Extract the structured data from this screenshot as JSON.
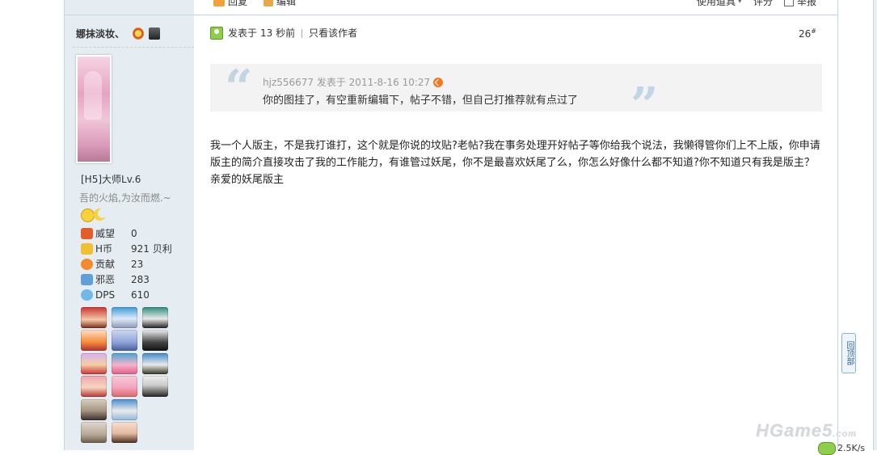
{
  "prev_post_actions": {
    "reply": "回复",
    "edit": "编辑",
    "use_item": "使用道具",
    "rate": "评分",
    "report": "举报"
  },
  "author": {
    "name": "娜抹淡妆、",
    "level": "[H5]大师Lv.6",
    "signature": "吾的火焰,为汝而燃.~",
    "stats": [
      {
        "label": "威望",
        "value": "0",
        "icon": "crown-icon"
      },
      {
        "label": "H币",
        "value": "921 贝利",
        "icon": "coin-icon"
      },
      {
        "label": "贡献",
        "value": "23",
        "icon": "heart-icon"
      },
      {
        "label": "邪恶",
        "value": "283",
        "icon": "devil-icon"
      },
      {
        "label": "DPS",
        "value": "610",
        "icon": "star-icon"
      }
    ]
  },
  "post": {
    "posted_label": "发表于",
    "posted_time": "13 秒前",
    "only_author": "只看该作者",
    "floor": "26",
    "floor_suffix": "#",
    "quote": {
      "meta": "hjz556677 发表于 2011-8-16 10:27",
      "text": "你的图挂了，有空重新编辑下，帖子不错，但自己打推荐就有点过了"
    },
    "content": "我一个人版主，不是我打谁打，这个就是你说的坟贴?老帖?我在事务处理开好帖子等你给我个说法，我懒得管你们上不上版，你申请版主的简介直接攻击了我的工作能力，有谁管过妖尾，你不是最喜欢妖尾了么，你怎么好像什么都不知道?你不知道只有我是版主？　亲爱的妖尾版主"
  },
  "back_to_top": "回顶部",
  "watermark": "HGame5",
  "watermark_suffix": ".com",
  "corner_text": "2.5K/s"
}
